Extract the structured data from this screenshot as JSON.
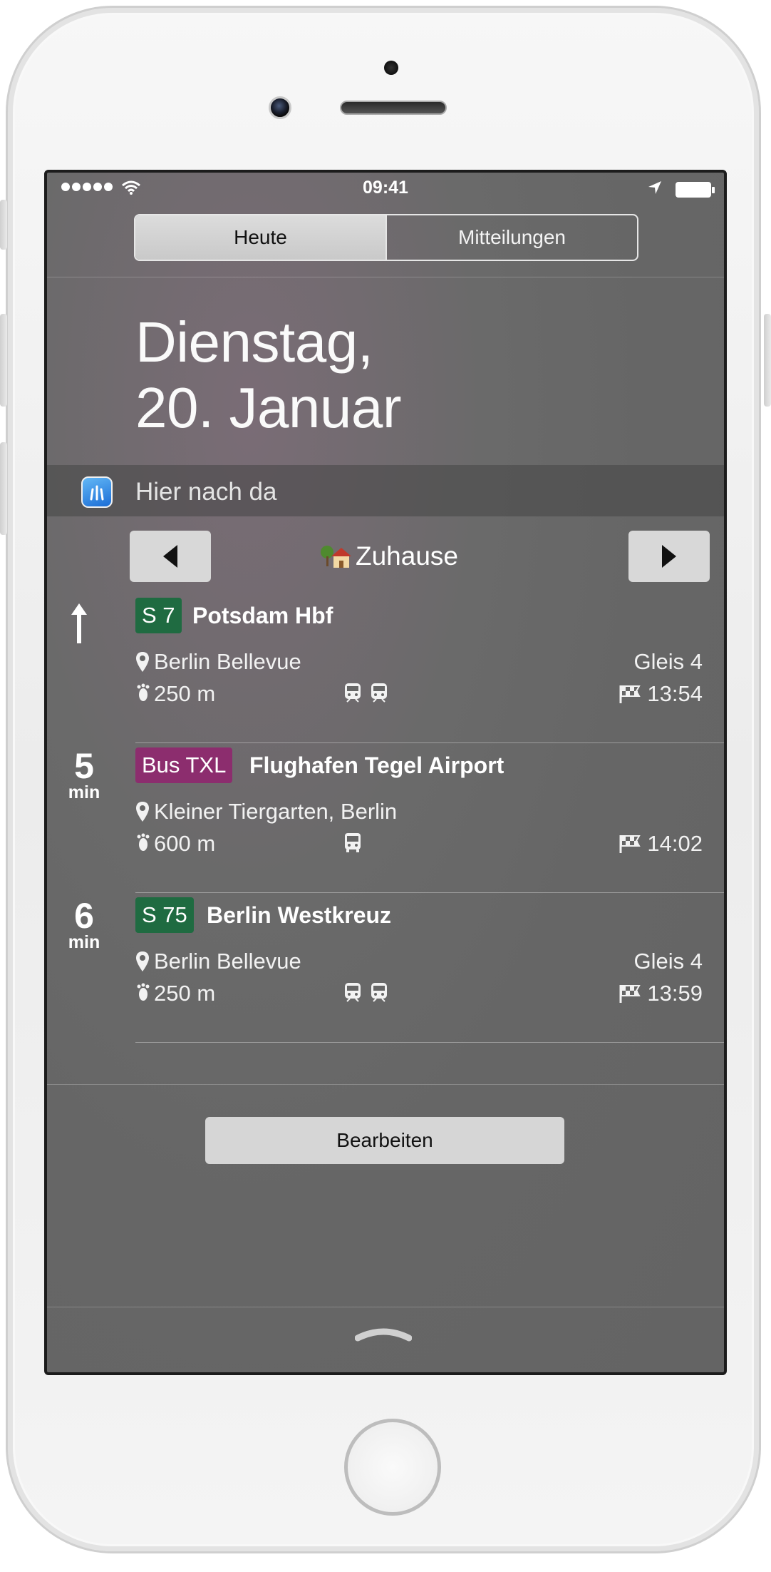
{
  "status_bar": {
    "time": "09:41"
  },
  "tabs": [
    {
      "label": "Heute"
    },
    {
      "label": "Mitteilungen"
    }
  ],
  "date": {
    "line1": "Dienstag,",
    "line2": "20. Januar"
  },
  "widget": {
    "title": "Hier nach da",
    "destination": "Zuhause",
    "connections": [
      {
        "eta_value": "",
        "eta_unit": "",
        "leaving_now": true,
        "line": "S 7",
        "line_color": "#1f6b41",
        "destination": "Potsdam Hbf",
        "stop": "Berlin Bellevue",
        "platform": "Gleis 4",
        "walk": "250 m",
        "arrival": "13:54"
      },
      {
        "eta_value": "5",
        "eta_unit": "min",
        "leaving_now": false,
        "line": "Bus TXL",
        "line_color": "#8c2d6e",
        "destination": "Flughafen Tegel Airport",
        "stop": "Kleiner Tiergarten, Berlin",
        "platform": "",
        "walk": "600 m",
        "arrival": "14:02"
      },
      {
        "eta_value": "6",
        "eta_unit": "min",
        "leaving_now": false,
        "line": "S 75",
        "line_color": "#1f6b41",
        "destination": "Berlin Westkreuz",
        "stop": "Berlin Bellevue",
        "platform": "Gleis 4",
        "walk": "250 m",
        "arrival": "13:59"
      }
    ]
  },
  "edit_button": {
    "label": "Bearbeiten"
  },
  "icons": {
    "app": "hier-nach-da-app-icon",
    "prev": "triangle-left-icon",
    "next": "triangle-right-icon",
    "location_pin": "map-pin-icon",
    "walk": "footprints-icon",
    "train": "train-icon",
    "bus": "bus-icon",
    "arrival": "finish-flag-icon",
    "grabber": "chevron-up-handle-icon"
  }
}
